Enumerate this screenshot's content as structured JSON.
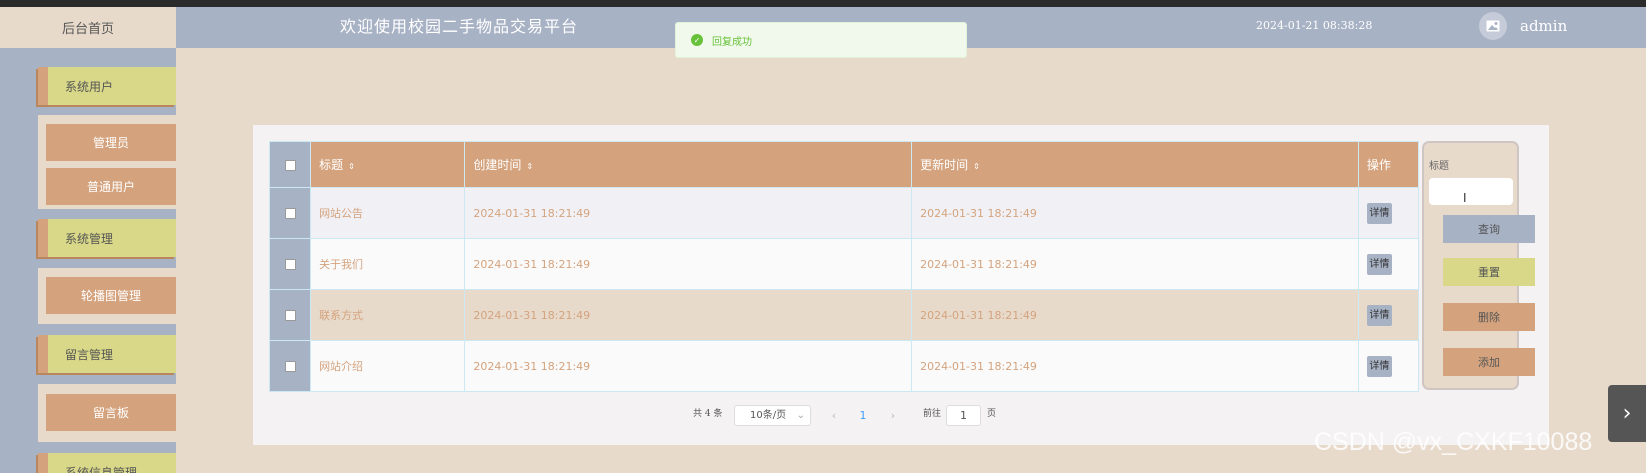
{
  "header": {
    "home": "后台首页",
    "title": "欢迎使用校园二手物品交易平台",
    "datetime": "2024-01-21 08:38:28",
    "user": "admin"
  },
  "toast": {
    "message": "回复成功"
  },
  "sidebar": {
    "groups": [
      {
        "label": "系统用户",
        "items": [
          "管理员",
          "普通用户"
        ]
      },
      {
        "label": "系统管理",
        "items": [
          "轮播图管理"
        ]
      },
      {
        "label": "留言管理",
        "items": [
          "留言板"
        ]
      },
      {
        "label": "系统信息管理",
        "items": []
      }
    ]
  },
  "table": {
    "headers": [
      "标题",
      "创建时间",
      "更新时间",
      "操作"
    ],
    "rows": [
      {
        "title": "网站公告",
        "created": "2024-01-31 18:21:49",
        "updated": "2024-01-31 18:21:49",
        "action": "详情"
      },
      {
        "title": "关于我们",
        "created": "2024-01-31 18:21:49",
        "updated": "2024-01-31 18:21:49",
        "action": "详情"
      },
      {
        "title": "联系方式",
        "created": "2024-01-31 18:21:49",
        "updated": "2024-01-31 18:21:49",
        "action": "详情"
      },
      {
        "title": "网站介绍",
        "created": "2024-01-31 18:21:49",
        "updated": "2024-01-31 18:21:49",
        "action": "详情"
      }
    ]
  },
  "search": {
    "label": "标题",
    "query": "查询",
    "reset": "重置",
    "delete": "删除",
    "add": "添加"
  },
  "pagination": {
    "total": "共 4 条",
    "page_size": "10条/页",
    "current": "1",
    "goto": "前往",
    "goto_value": "1",
    "page_suffix": "页"
  },
  "watermark": "CSDN @vx_CXKF10088",
  "colors": {
    "header": "#a8b2c5",
    "background": "#e8dacb",
    "accent": "#d4a37e",
    "menu": "#d8d888",
    "success": "#67c23a"
  }
}
